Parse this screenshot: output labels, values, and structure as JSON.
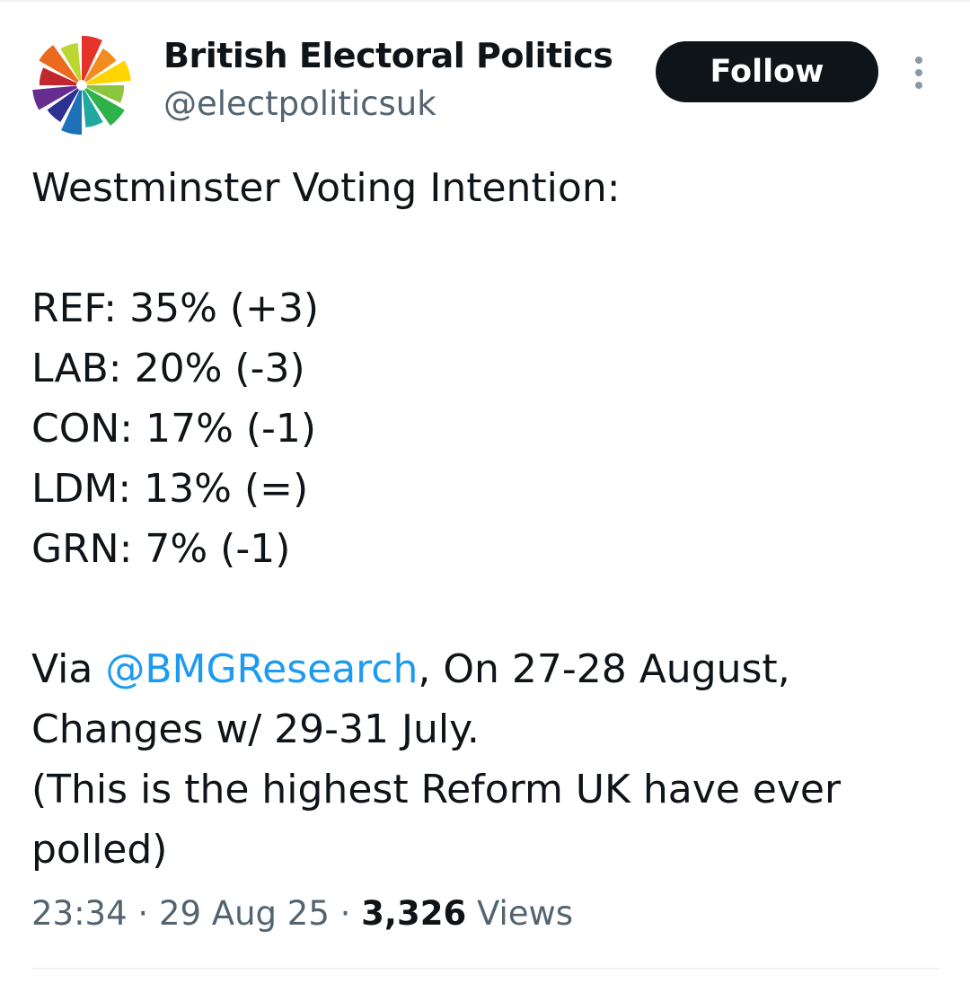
{
  "account": {
    "name": "British Electoral Politics",
    "handle": "@electpoliticsuk",
    "follow_label": "Follow",
    "avatar_icon": "rainbow-pinwheel-icon",
    "avatar_colors": [
      "#e6332a",
      "#f28c1f",
      "#ffd500",
      "#8cc63f",
      "#2db34a",
      "#1fa9a0",
      "#1d71b8",
      "#2e3192",
      "#662d91",
      "#c1272d",
      "#ec6a1f",
      "#bcd630"
    ]
  },
  "menu": {
    "more_icon": "more-vertical-icon"
  },
  "tweet": {
    "heading": "Westminster Voting Intention:",
    "results": [
      "REF: 35% (+3)",
      "LAB: 20% (-3)",
      "CON: 17% (-1)",
      "LDM: 13% (=)",
      "GRN: 7% (-1)"
    ],
    "via_prefix": "Via ",
    "via_mention": "@BMGResearch",
    "via_suffix": ", On 27-28 August,",
    "changes_line": "Changes w/ 29-31 July.",
    "note_line_1": "(This is the highest Reform UK have ever",
    "note_line_2": "polled)"
  },
  "meta": {
    "time": "23:34",
    "separator": "·",
    "date": "29 Aug 25",
    "views_count": "3,326",
    "views_label": "Views"
  },
  "colors": {
    "text": "#0f1419",
    "secondary": "#536471",
    "link": "#1d9bf0",
    "button_bg": "#0f1419",
    "button_text": "#ffffff"
  }
}
